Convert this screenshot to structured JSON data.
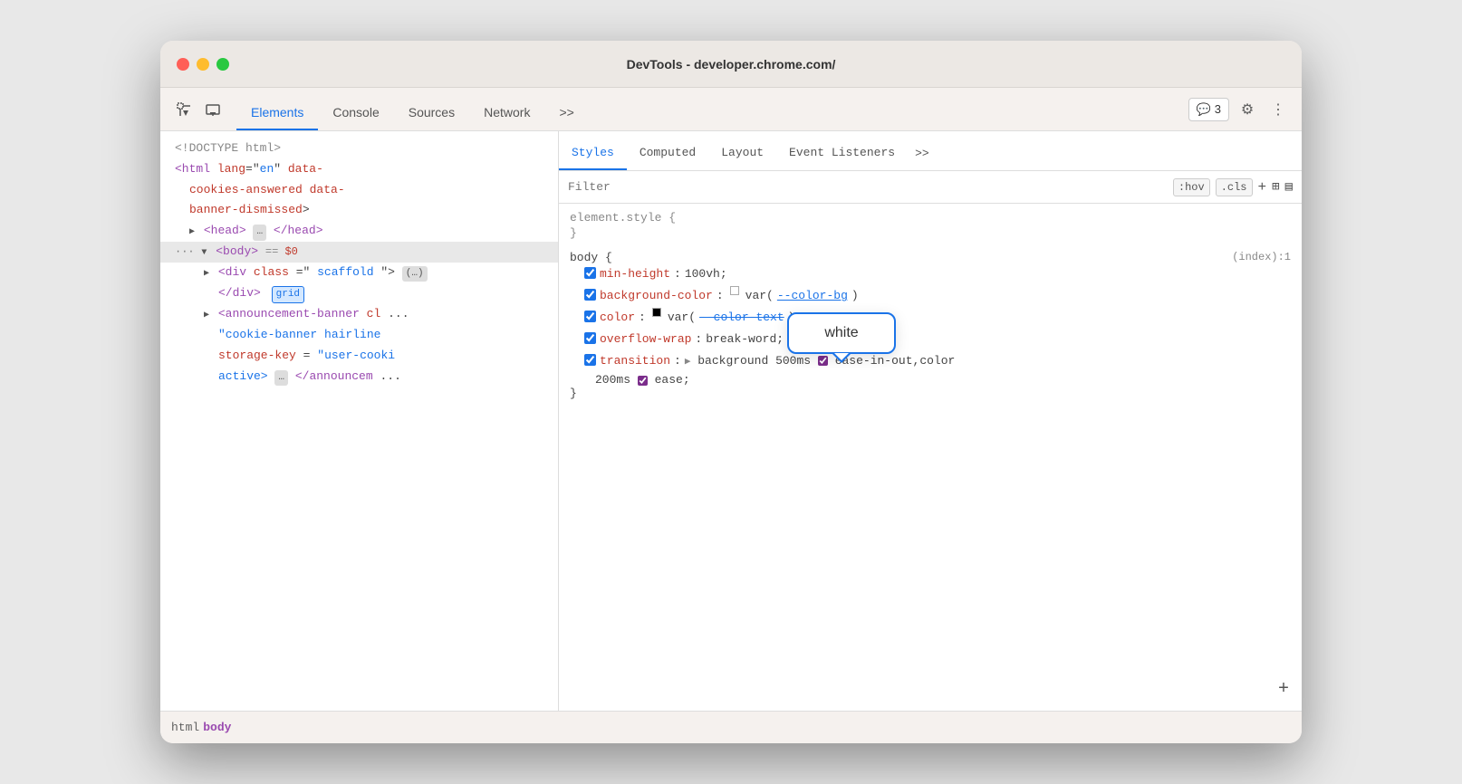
{
  "window": {
    "title": "DevTools - developer.chrome.com/"
  },
  "toolbar": {
    "tabs": [
      {
        "label": "Elements",
        "active": true
      },
      {
        "label": "Console",
        "active": false
      },
      {
        "label": "Sources",
        "active": false
      },
      {
        "label": "Network",
        "active": false
      },
      {
        "label": ">>",
        "active": false
      }
    ],
    "badge_label": "3",
    "settings_icon": "⚙",
    "more_icon": "⋮"
  },
  "dom": {
    "lines": [
      {
        "text": "<!DOCTYPE html>",
        "class": "color-gray",
        "indent": 0
      },
      {
        "text": "<html lang=\"en\" data-cookies-answered data-banner-dismissed>",
        "indent": 0,
        "isHtml": true
      },
      {
        "text": "▶ <head> ... </head>",
        "indent": 1,
        "isHead": true
      },
      {
        "text": "··· ▼ <body> == $0",
        "indent": 0,
        "isBody": true,
        "highlighted": true
      },
      {
        "text": "▶ <div class=\"scaffold\"> (...)",
        "indent": 2,
        "isDiv": true
      },
      {
        "text": "</div>",
        "indent": 3,
        "hasGridBadge": true
      },
      {
        "text": "▶ <announcement-banner cl...\"cookie-banner hairline...storage-key=\"user-cooki...active> ... </announcem...",
        "indent": 2,
        "isAnnounce": true
      }
    ]
  },
  "breadcrumb": {
    "items": [
      "html",
      "body"
    ]
  },
  "styles_panel": {
    "tabs": [
      {
        "label": "Styles",
        "active": true
      },
      {
        "label": "Computed",
        "active": false
      },
      {
        "label": "Layout",
        "active": false
      },
      {
        "label": "Event Listeners",
        "active": false
      },
      {
        "label": ">>",
        "active": false
      }
    ],
    "filter": {
      "placeholder": "Filter",
      "hov_label": ":hov",
      "cls_label": ".cls",
      "plus_label": "+",
      "icon1": "📋",
      "icon2": "☐"
    },
    "rules": [
      {
        "selector": "element.style {",
        "close": "}",
        "origin": "",
        "props": []
      },
      {
        "selector": "body {",
        "close": "}",
        "origin": "(index):1",
        "props": [
          {
            "name": "min-height",
            "value": "100vh;",
            "checked": true
          },
          {
            "name": "background-color",
            "value_pre": "",
            "has_swatch": true,
            "swatch_color": "#ffffff",
            "value_link": "--color-bg",
            "checked": true,
            "is_bg": true
          },
          {
            "name": "color",
            "value_pre": "",
            "has_swatch": true,
            "swatch_color": "#000000",
            "value_link": "--color-text",
            "checked": true,
            "is_color": true
          },
          {
            "name": "overflow-wrap",
            "value": "break-word;",
            "checked": true
          },
          {
            "name": "transition",
            "value_complex": true,
            "checked": true
          }
        ]
      }
    ],
    "tooltip": {
      "text": "white"
    },
    "transition_value": "▶ background 500ms",
    "transition_ease": "ease-in-out,color",
    "transition_line2": "200ms",
    "transition_ease2": "ease;"
  }
}
